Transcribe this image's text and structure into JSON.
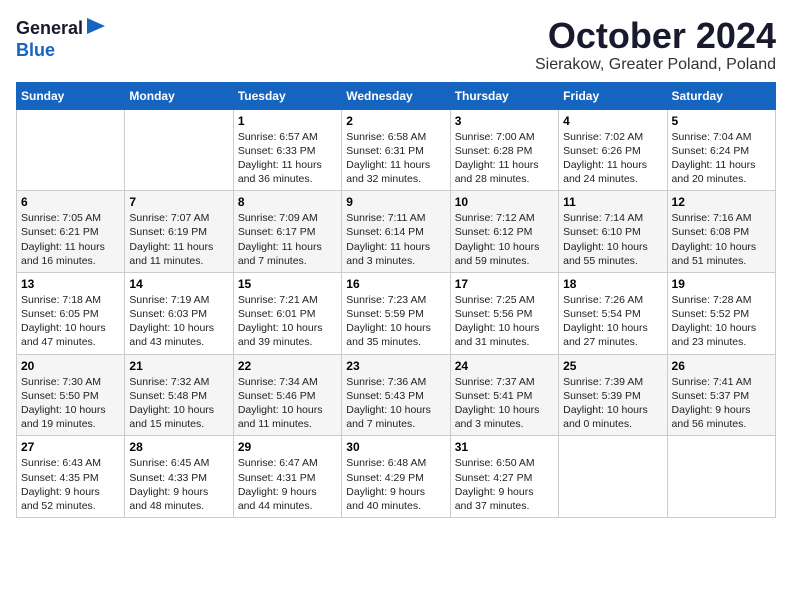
{
  "header": {
    "logo_line1": "General",
    "logo_line2": "Blue",
    "month": "October 2024",
    "location": "Sierakow, Greater Poland, Poland"
  },
  "weekdays": [
    "Sunday",
    "Monday",
    "Tuesday",
    "Wednesday",
    "Thursday",
    "Friday",
    "Saturday"
  ],
  "weeks": [
    [
      {
        "day": "",
        "info": ""
      },
      {
        "day": "",
        "info": ""
      },
      {
        "day": "1",
        "info": "Sunrise: 6:57 AM\nSunset: 6:33 PM\nDaylight: 11 hours\nand 36 minutes."
      },
      {
        "day": "2",
        "info": "Sunrise: 6:58 AM\nSunset: 6:31 PM\nDaylight: 11 hours\nand 32 minutes."
      },
      {
        "day": "3",
        "info": "Sunrise: 7:00 AM\nSunset: 6:28 PM\nDaylight: 11 hours\nand 28 minutes."
      },
      {
        "day": "4",
        "info": "Sunrise: 7:02 AM\nSunset: 6:26 PM\nDaylight: 11 hours\nand 24 minutes."
      },
      {
        "day": "5",
        "info": "Sunrise: 7:04 AM\nSunset: 6:24 PM\nDaylight: 11 hours\nand 20 minutes."
      }
    ],
    [
      {
        "day": "6",
        "info": "Sunrise: 7:05 AM\nSunset: 6:21 PM\nDaylight: 11 hours\nand 16 minutes."
      },
      {
        "day": "7",
        "info": "Sunrise: 7:07 AM\nSunset: 6:19 PM\nDaylight: 11 hours\nand 11 minutes."
      },
      {
        "day": "8",
        "info": "Sunrise: 7:09 AM\nSunset: 6:17 PM\nDaylight: 11 hours\nand 7 minutes."
      },
      {
        "day": "9",
        "info": "Sunrise: 7:11 AM\nSunset: 6:14 PM\nDaylight: 11 hours\nand 3 minutes."
      },
      {
        "day": "10",
        "info": "Sunrise: 7:12 AM\nSunset: 6:12 PM\nDaylight: 10 hours\nand 59 minutes."
      },
      {
        "day": "11",
        "info": "Sunrise: 7:14 AM\nSunset: 6:10 PM\nDaylight: 10 hours\nand 55 minutes."
      },
      {
        "day": "12",
        "info": "Sunrise: 7:16 AM\nSunset: 6:08 PM\nDaylight: 10 hours\nand 51 minutes."
      }
    ],
    [
      {
        "day": "13",
        "info": "Sunrise: 7:18 AM\nSunset: 6:05 PM\nDaylight: 10 hours\nand 47 minutes."
      },
      {
        "day": "14",
        "info": "Sunrise: 7:19 AM\nSunset: 6:03 PM\nDaylight: 10 hours\nand 43 minutes."
      },
      {
        "day": "15",
        "info": "Sunrise: 7:21 AM\nSunset: 6:01 PM\nDaylight: 10 hours\nand 39 minutes."
      },
      {
        "day": "16",
        "info": "Sunrise: 7:23 AM\nSunset: 5:59 PM\nDaylight: 10 hours\nand 35 minutes."
      },
      {
        "day": "17",
        "info": "Sunrise: 7:25 AM\nSunset: 5:56 PM\nDaylight: 10 hours\nand 31 minutes."
      },
      {
        "day": "18",
        "info": "Sunrise: 7:26 AM\nSunset: 5:54 PM\nDaylight: 10 hours\nand 27 minutes."
      },
      {
        "day": "19",
        "info": "Sunrise: 7:28 AM\nSunset: 5:52 PM\nDaylight: 10 hours\nand 23 minutes."
      }
    ],
    [
      {
        "day": "20",
        "info": "Sunrise: 7:30 AM\nSunset: 5:50 PM\nDaylight: 10 hours\nand 19 minutes."
      },
      {
        "day": "21",
        "info": "Sunrise: 7:32 AM\nSunset: 5:48 PM\nDaylight: 10 hours\nand 15 minutes."
      },
      {
        "day": "22",
        "info": "Sunrise: 7:34 AM\nSunset: 5:46 PM\nDaylight: 10 hours\nand 11 minutes."
      },
      {
        "day": "23",
        "info": "Sunrise: 7:36 AM\nSunset: 5:43 PM\nDaylight: 10 hours\nand 7 minutes."
      },
      {
        "day": "24",
        "info": "Sunrise: 7:37 AM\nSunset: 5:41 PM\nDaylight: 10 hours\nand 3 minutes."
      },
      {
        "day": "25",
        "info": "Sunrise: 7:39 AM\nSunset: 5:39 PM\nDaylight: 10 hours\nand 0 minutes."
      },
      {
        "day": "26",
        "info": "Sunrise: 7:41 AM\nSunset: 5:37 PM\nDaylight: 9 hours\nand 56 minutes."
      }
    ],
    [
      {
        "day": "27",
        "info": "Sunrise: 6:43 AM\nSunset: 4:35 PM\nDaylight: 9 hours\nand 52 minutes."
      },
      {
        "day": "28",
        "info": "Sunrise: 6:45 AM\nSunset: 4:33 PM\nDaylight: 9 hours\nand 48 minutes."
      },
      {
        "day": "29",
        "info": "Sunrise: 6:47 AM\nSunset: 4:31 PM\nDaylight: 9 hours\nand 44 minutes."
      },
      {
        "day": "30",
        "info": "Sunrise: 6:48 AM\nSunset: 4:29 PM\nDaylight: 9 hours\nand 40 minutes."
      },
      {
        "day": "31",
        "info": "Sunrise: 6:50 AM\nSunset: 4:27 PM\nDaylight: 9 hours\nand 37 minutes."
      },
      {
        "day": "",
        "info": ""
      },
      {
        "day": "",
        "info": ""
      }
    ]
  ]
}
